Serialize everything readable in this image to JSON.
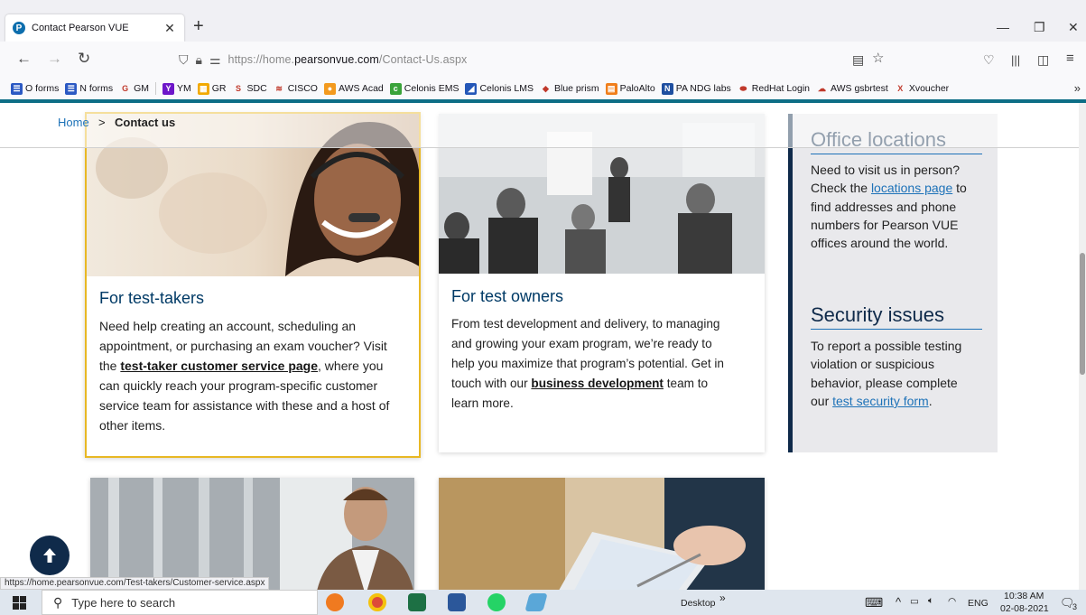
{
  "browser": {
    "tab_title": "Contact Pearson VUE",
    "tab_favicon": "P",
    "url_prefix": "https://home.",
    "url_domain": "pearsonvue.com",
    "url_path": "/Contact-Us.aspx",
    "bookmarks": [
      {
        "label": "O forms",
        "color": "#2b59c3",
        "glyph": "☰"
      },
      {
        "label": "N forms",
        "color": "#2b59c3",
        "glyph": "☰"
      },
      {
        "label": "GM",
        "color": "#ffffff",
        "glyph": "G"
      },
      {
        "label": "YM",
        "color": "#6d16c9",
        "glyph": "Y"
      },
      {
        "label": "GR",
        "color": "#f2a900",
        "glyph": "▦"
      },
      {
        "label": "SDC",
        "color": "#ffffff",
        "glyph": "S"
      },
      {
        "label": "CISCO",
        "color": "#ffffff",
        "glyph": "≋"
      },
      {
        "label": "AWS Acad",
        "color": "#f39a1e",
        "glyph": "●"
      },
      {
        "label": "Celonis EMS",
        "color": "#3aa33a",
        "glyph": "c"
      },
      {
        "label": "Celonis LMS",
        "color": "#2457b8",
        "glyph": "◢"
      },
      {
        "label": "Blue prism",
        "color": "#ffffff",
        "glyph": "◆"
      },
      {
        "label": "PaloAlto",
        "color": "#f07e1b",
        "glyph": "▤"
      },
      {
        "label": "PA NDG labs",
        "color": "#1f4fa0",
        "glyph": "N"
      },
      {
        "label": "RedHat Login",
        "color": "#ffffff",
        "glyph": "⬬"
      },
      {
        "label": "AWS gsbrtest",
        "color": "#ffffff",
        "glyph": "☁"
      },
      {
        "label": "Xvoucher",
        "color": "#ffffff",
        "glyph": "X"
      }
    ]
  },
  "breadcrumb": {
    "home": "Home",
    "separator": ">",
    "current": "Contact us"
  },
  "cards": [
    {
      "title": "For test-takers",
      "line1": "Need help creating an account, scheduling an",
      "line2": "appointment, or purchasing an exam voucher? Visit",
      "line3_pre": "the ",
      "line3_link": "test-taker customer service page",
      "line3_post": ", where you",
      "line4": "can quickly reach your program-specific customer",
      "line5": "service team for assistance with these and a host of",
      "line6": "other items."
    },
    {
      "title": "For test owners",
      "line1": "From test development and delivery, to managing",
      "line2": "and growing your exam program, we’re ready to",
      "line3": "help you maximize that program’s potential. Get in",
      "line4_pre": "touch with our ",
      "line4_link": "business development",
      "line4_post": " team to",
      "line5": "learn more."
    }
  ],
  "sidebar": {
    "office_heading": "Office locations",
    "office_l1": "Need to visit us in person?",
    "office_l2_pre": "Check the ",
    "office_l2_link": "locations page",
    "office_l2_post": " to",
    "office_l3": "find addresses and phone",
    "office_l4": "numbers for Pearson VUE",
    "office_l5": "offices around the world.",
    "security_heading": "Security issues",
    "security_l1": "To report a possible testing",
    "security_l2": "violation or suspicious",
    "security_l3": "behavior, please complete",
    "security_l4_pre": "our ",
    "security_l4_link": "test security form",
    "security_l4_post": "."
  },
  "status_url": "https://home.pearsonvue.com/Test-takers/Customer-service.aspx",
  "taskbar": {
    "search_placeholder": "Type here to search",
    "desktop_label": "Desktop",
    "language": "ENG",
    "time": "10:38 AM",
    "date": "02-08-2021",
    "notification_count": "3"
  }
}
